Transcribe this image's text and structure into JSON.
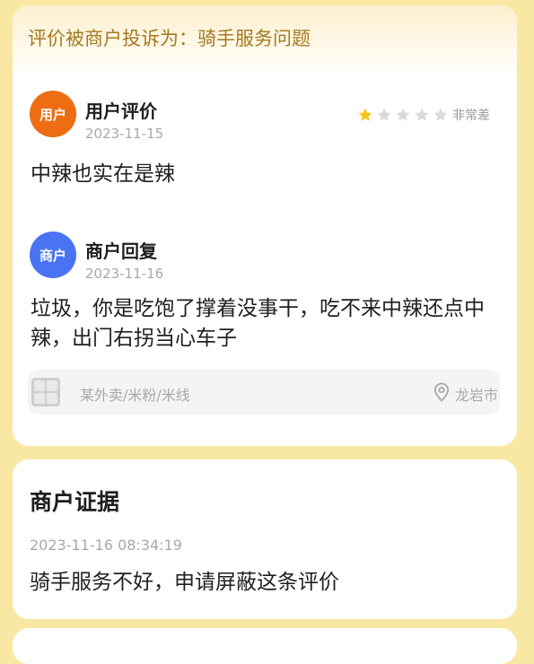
{
  "complaint": {
    "label": "评价被商户投诉为：骑手服务问题"
  },
  "user_review": {
    "avatar_label": "用户",
    "title": "用户评价",
    "date": "2023-11-15",
    "rating": 1,
    "rating_max": 5,
    "rating_text": "非常差",
    "content": "中辣也实在是辣"
  },
  "merchant_reply": {
    "avatar_label": "商户",
    "title": "商户回复",
    "date": "2023-11-16",
    "content": "垃圾，你是吃饱了撑着没事干，吃不来中辣还点中辣，出门右拐当心车子"
  },
  "shop": {
    "name": "某外卖/米粉/米线",
    "city": "龙岩市"
  },
  "evidence": {
    "title": "商户证据",
    "datetime": "2023-11-16 08:34:19",
    "content": "骑手服务不好，申请屏蔽这条评价"
  },
  "colors": {
    "page_bg": "#f9e8a4",
    "complaint_text": "#a57a1f",
    "user_avatar": "#ee6d12",
    "merchant_avatar": "#4a73f4",
    "star_filled": "#f5c518",
    "star_empty": "#d9d9d9"
  }
}
